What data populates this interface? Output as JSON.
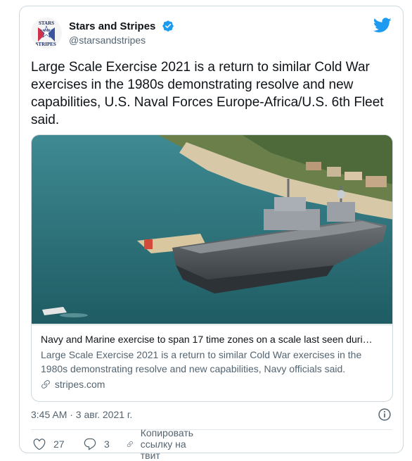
{
  "author": {
    "display_name": "Stars and Stripes",
    "handle": "@starsandstripes",
    "avatar_logo_text_top": "STARS",
    "avatar_logo_text_mid": "AND",
    "avatar_logo_text_bottom": "STRIPES."
  },
  "tweet": {
    "text": "Large Scale Exercise 2021 is a return to similar Cold War exercises in the 1980s demonstrating resolve and new capabilities, U.S. Naval Forces Europe-Africa/U.S. 6th Fleet said."
  },
  "link_card": {
    "title": "Navy and Marine exercise to span 17 time zones on a scale last seen duri…",
    "description": "Large Scale Exercise 2021 is a return to similar Cold War exercises in the 1980s demonstrating resolve and new capabilities, Navy officials said.",
    "domain": "stripes.com"
  },
  "meta": {
    "timestamp": "3:45 AM · 3 авг. 2021 г."
  },
  "actions": {
    "like_count": "27",
    "reply_count": "3",
    "copy_link_label": "Копировать ссылку на твит"
  },
  "colors": {
    "twitter_blue": "#1d9bf0",
    "secondary_text": "#536471",
    "border": "#cfd9de"
  },
  "icons": [
    "verified-badge-icon",
    "twitter-bird-icon",
    "link-icon",
    "info-icon",
    "heart-icon",
    "reply-icon",
    "copy-link-icon"
  ]
}
